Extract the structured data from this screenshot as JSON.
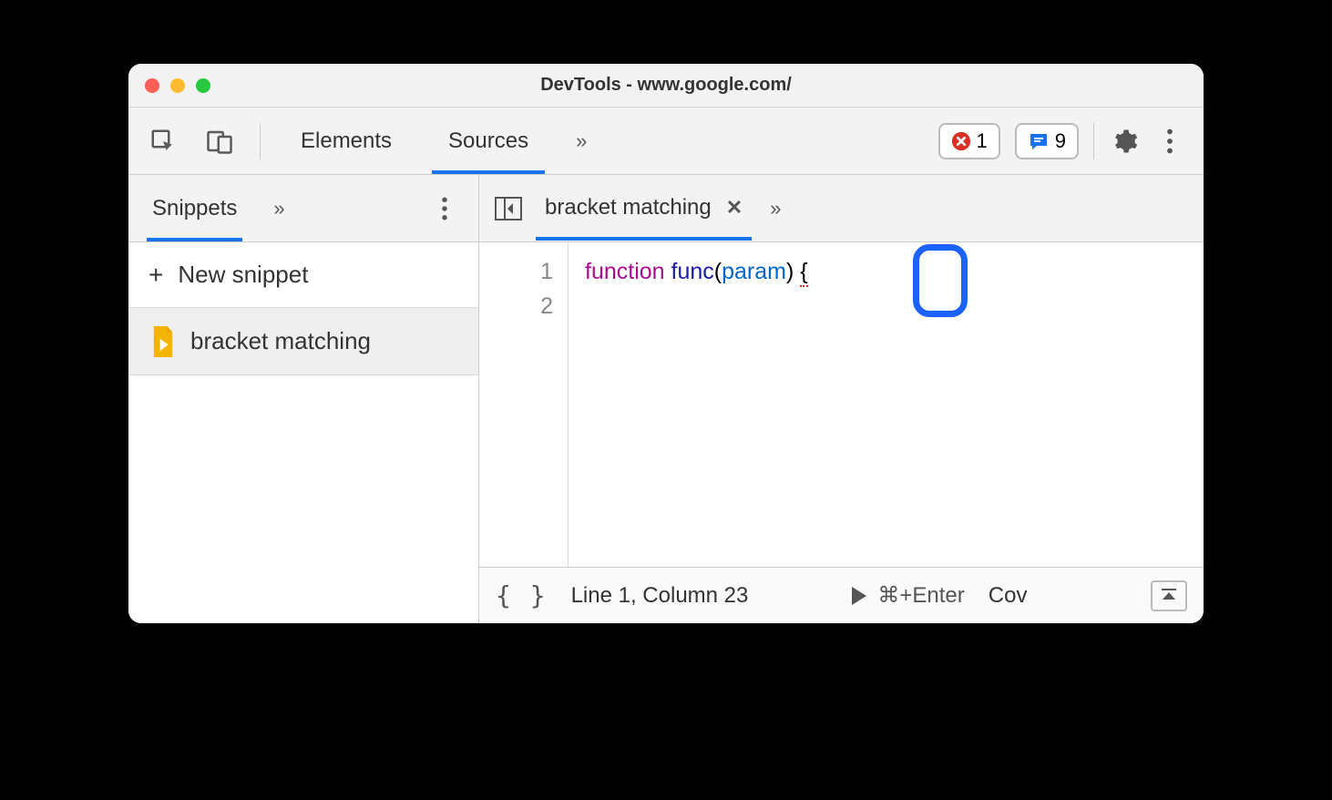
{
  "window": {
    "title": "DevTools - www.google.com/"
  },
  "toolbar": {
    "tabs": {
      "elements": "Elements",
      "sources": "Sources"
    },
    "errors_count": "1",
    "messages_count": "9"
  },
  "sidebar": {
    "tab_label": "Snippets",
    "new_snippet_label": "New snippet",
    "items": [
      {
        "label": "bracket matching"
      }
    ]
  },
  "editor": {
    "tab_label": "bracket matching",
    "gutter": [
      "1",
      "2"
    ],
    "code": {
      "keyword": "function",
      "func": "func",
      "param": "param",
      "open_paren": "(",
      "close_paren": ")",
      "brace": "{"
    }
  },
  "statusbar": {
    "pretty": "{ }",
    "position": "Line 1, Column 23",
    "run_shortcut": "⌘+Enter",
    "coverage": "Cov"
  }
}
